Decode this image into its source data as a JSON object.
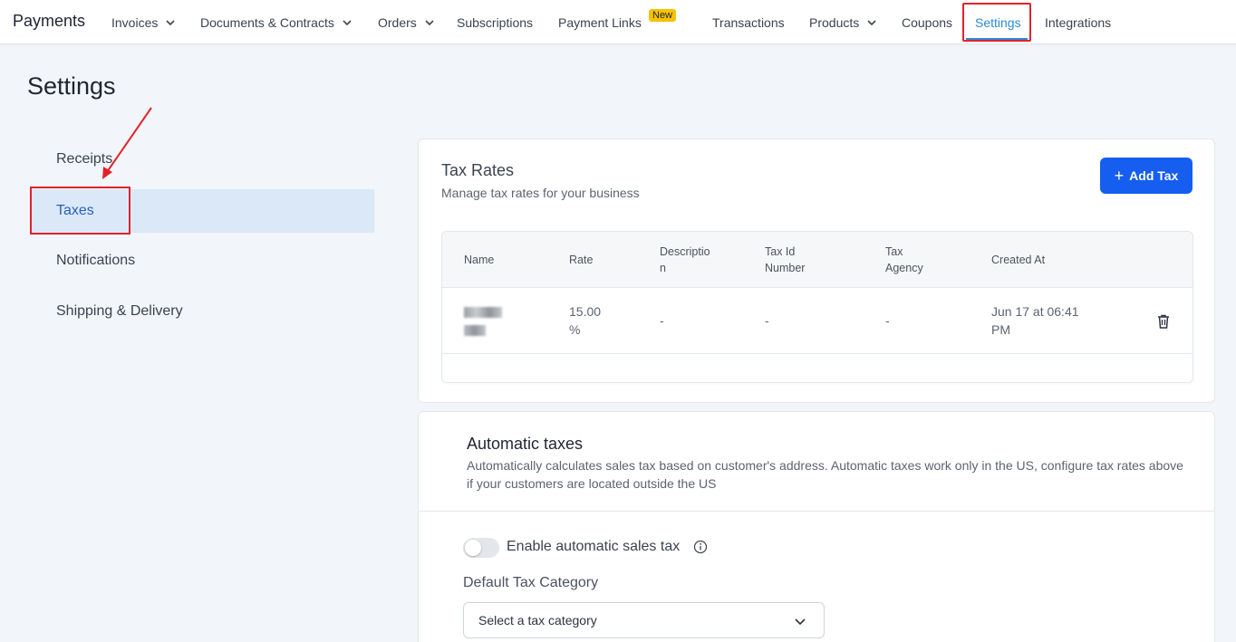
{
  "app": {
    "title": "Payments"
  },
  "nav": {
    "invoices": "Invoices",
    "documents": "Documents & Contracts",
    "orders": "Orders",
    "subscriptions": "Subscriptions",
    "payment_links": "Payment Links",
    "new_badge": "New",
    "transactions": "Transactions",
    "products": "Products",
    "coupons": "Coupons",
    "settings": "Settings",
    "integrations": "Integrations"
  },
  "page": {
    "title": "Settings"
  },
  "sidebar": {
    "items": [
      {
        "label": "Receipts"
      },
      {
        "label": "Taxes"
      },
      {
        "label": "Notifications"
      },
      {
        "label": "Shipping & Delivery"
      }
    ]
  },
  "tax_rates": {
    "title": "Tax Rates",
    "subtitle": "Manage tax rates for your business",
    "add_button": "Add Tax",
    "columns": {
      "name": "Name",
      "rate": "Rate",
      "description_line1": "Descriptio",
      "description_line2": "n",
      "tax_id_line1": "Tax Id",
      "tax_id_line2": "Number",
      "agency_line1": "Tax",
      "agency_line2": "Agency",
      "created_at": "Created At"
    },
    "rows": [
      {
        "rate_line1": "15.00",
        "rate_line2": "%",
        "description": "-",
        "tax_id": "-",
        "agency": "-",
        "created_line1": "Jun 17 at 06:41",
        "created_line2": "PM"
      }
    ]
  },
  "automatic_taxes": {
    "title": "Automatic taxes",
    "description": "Automatically calculates sales tax based on customer's address. Automatic taxes work only in the US, configure tax rates above if your customers are located outside the US",
    "toggle_label": "Enable automatic sales tax",
    "toggle_on": false,
    "category_label": "Default Tax Category",
    "category_select": "Select a tax category"
  },
  "colors": {
    "accent": "#155eef",
    "active_nav": "#2b8ad6",
    "highlight_box": "#e0232b",
    "badge": "#f6c200"
  }
}
